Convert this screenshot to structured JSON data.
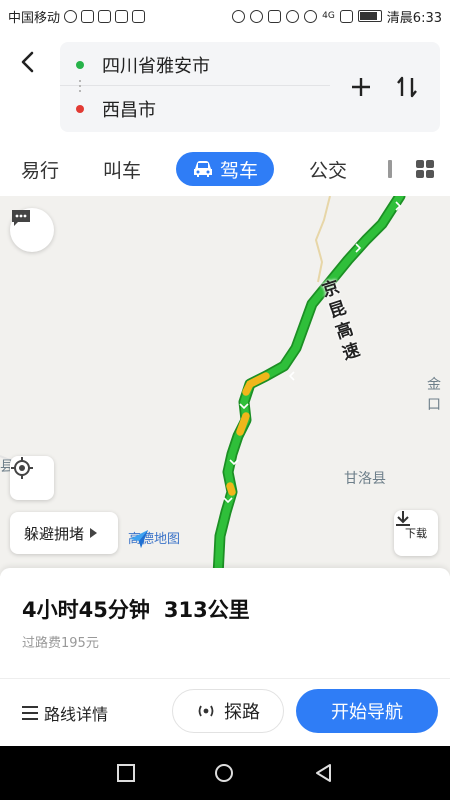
{
  "status_bar": {
    "carrier": "中国移动",
    "network": "4G",
    "clock": "清晨6:33"
  },
  "header": {
    "from": "四川省雅安市",
    "to": "西昌市"
  },
  "tabs": [
    {
      "label": "易行"
    },
    {
      "label": "叫车"
    },
    {
      "label": "驾车",
      "active": true
    },
    {
      "label": "公交"
    }
  ],
  "map": {
    "road_name": [
      "京",
      "昆",
      "高",
      "速"
    ],
    "place_labels": [
      "金口",
      "甘洛县",
      "县"
    ],
    "avoid_label": "躲避拥堵",
    "brand_label": "高德地图",
    "download_label": "下载",
    "colors": {
      "route_green": "#2fbf3a",
      "route_yellow": "#f0b61b",
      "route_border": "#1c8f24"
    }
  },
  "route": {
    "duration": "4小时45分钟",
    "distance": "313公里",
    "toll": "过路费195元"
  },
  "actions": {
    "detail_label": "路线详情",
    "probe_label": "探路",
    "start_label": "开始导航"
  },
  "accent": "#2f7df6"
}
